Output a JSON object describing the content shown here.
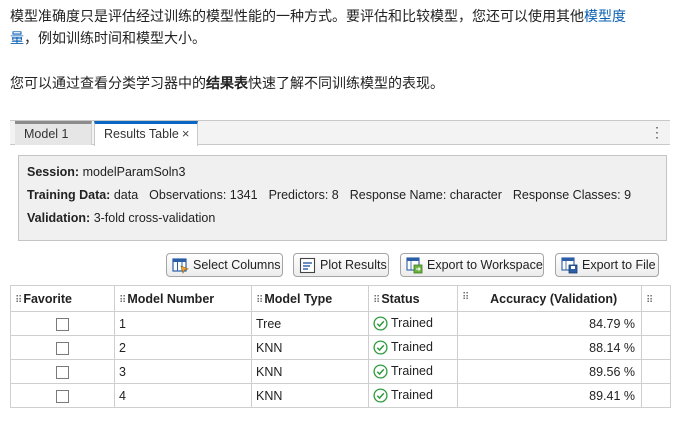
{
  "doc": {
    "para1_text": "模型准确度只是评估经过训练的模型性能的一种方式。要评估和比较模型，您还可以使用其他",
    "para1_link_part1": "模型度",
    "para1_link_part2": "量",
    "para1_tail": "，例如训练时间和模型大小。",
    "para2_pre": "您可以通过查看分类学习器中的",
    "para2_bold": "结果表",
    "para2_post": "快速了解不同训练模型的表现。"
  },
  "tabs": [
    {
      "label": "Model 1"
    },
    {
      "label": "Results Table",
      "close": "×"
    }
  ],
  "tab_menu": "⋮",
  "info": {
    "session_label": "Session:",
    "session_value": "modelParamSoln3",
    "training_label": "Training Data:",
    "training_value": "data",
    "observations": "Observations: 1341",
    "predictors": "Predictors: 8",
    "response_name": "Response Name: character",
    "response_classes": "Response Classes: 9",
    "validation_label": "Validation:",
    "validation_value": "3-fold cross-validation"
  },
  "toolbar": {
    "select_columns": "Select Columns",
    "plot_results": "Plot Results",
    "export_workspace": "Export to Workspace",
    "export_file": "Export to File"
  },
  "table": {
    "headers": [
      "Favorite",
      "Model Number",
      "Model Type",
      "Status",
      "Accuracy (Validation)"
    ],
    "rows": [
      {
        "number": "1",
        "type": "Tree",
        "status": "Trained",
        "accuracy": "84.79 %"
      },
      {
        "number": "2",
        "type": "KNN",
        "status": "Trained",
        "accuracy": "88.14 %"
      },
      {
        "number": "3",
        "type": "KNN",
        "status": "Trained",
        "accuracy": "89.56 %"
      },
      {
        "number": "4",
        "type": "KNN",
        "status": "Trained",
        "accuracy": "89.41 %"
      }
    ]
  },
  "colors": {
    "link": "#0a5fb4",
    "active_tab": "#0c67c4",
    "status_green": "#2e9b3c"
  }
}
